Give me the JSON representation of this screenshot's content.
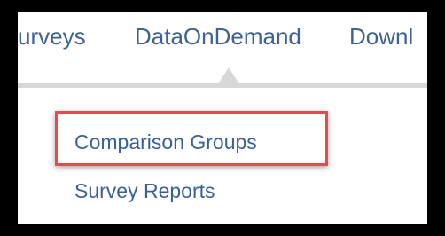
{
  "nav": {
    "items": [
      {
        "label": "urveys"
      },
      {
        "label": "DataOnDemand"
      },
      {
        "label": "Downl"
      }
    ]
  },
  "dropdown": {
    "items": [
      {
        "label": "Comparison Groups",
        "highlighted": true
      },
      {
        "label": "Survey Reports",
        "highlighted": false
      }
    ]
  },
  "colors": {
    "link": "#3f6293",
    "highlight_border": "#e44b4b",
    "menu_bar": "#d7d7d7",
    "outer_frame": "#000000"
  }
}
